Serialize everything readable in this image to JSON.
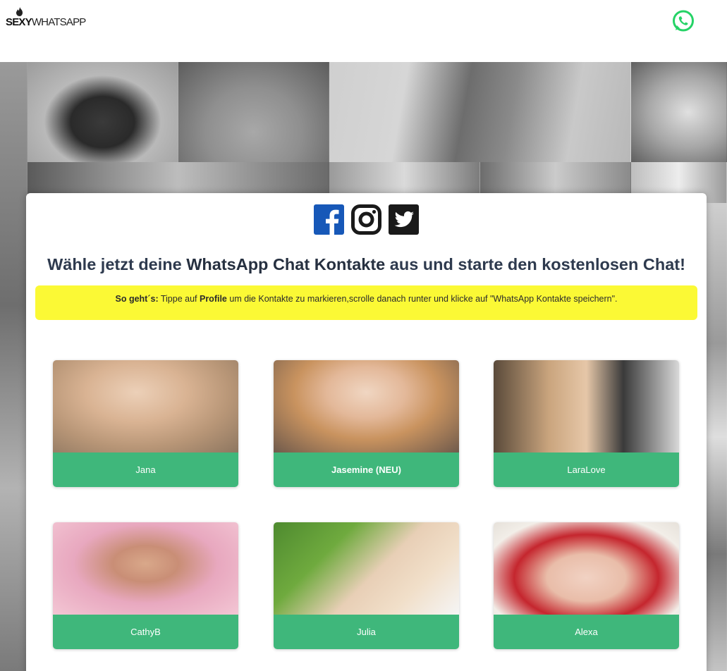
{
  "header": {
    "logo_bold": "SEXY",
    "logo_light": "WHATSAPP",
    "whatsapp_icon": "whatsapp-icon"
  },
  "social": [
    {
      "name": "facebook-icon",
      "color": "#1758b8"
    },
    {
      "name": "instagram-icon",
      "color": "#1a1a1a"
    },
    {
      "name": "twitter-icon",
      "color": "#1a1a1a"
    }
  ],
  "headline": {
    "pre": "Wähle jetzt deine ",
    "strong": "WhatsApp Chat Kontakte",
    "post": " aus und starte den kostenlosen Chat!"
  },
  "notice": {
    "lead": "So geht´s:",
    "part1": " Tippe auf ",
    "strong": "Profile",
    "part2": " um die Kontakte zu markieren,scrolle danach runter und klicke auf \"WhatsApp Kontakte speichern\"."
  },
  "profiles": [
    {
      "name": "Jana",
      "bold": false
    },
    {
      "name": "Jasemine (NEU)",
      "bold": true
    },
    {
      "name": "LaraLove",
      "bold": false
    },
    {
      "name": "CathyB",
      "bold": false
    },
    {
      "name": "Julia",
      "bold": false
    },
    {
      "name": "Alexa",
      "bold": false
    }
  ],
  "colors": {
    "accent_green": "#3fb77b",
    "notice_yellow": "#fbf935",
    "whatsapp_green": "#25d366",
    "facebook_blue": "#1758b8"
  }
}
